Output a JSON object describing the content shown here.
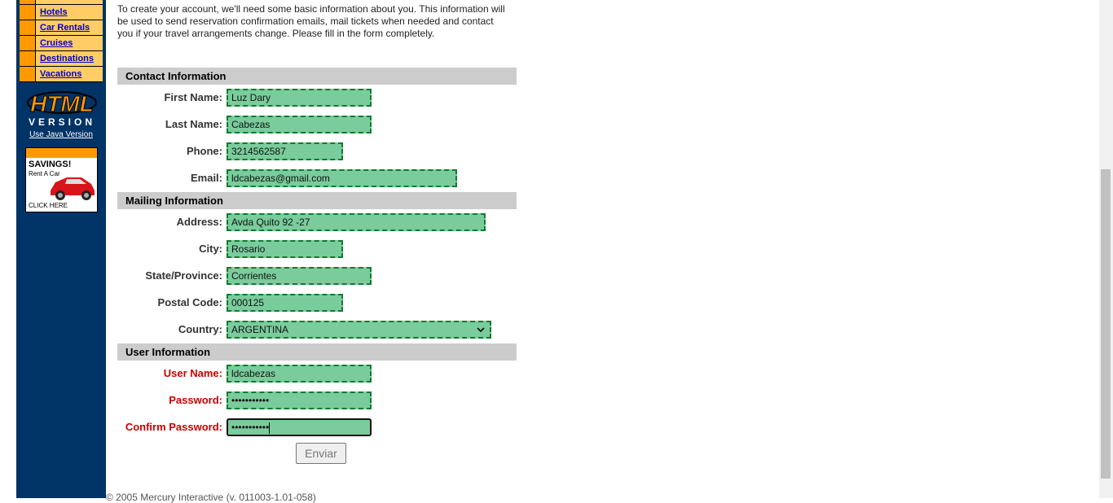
{
  "sidebar": {
    "nav_items": [
      "Hotels",
      "Car Rentals",
      "Cruises",
      "Destinations",
      "Vacations"
    ],
    "logo_line1": "HTML",
    "logo_line2": "VERSION",
    "java_link": "Use Java Version",
    "ad": {
      "title": "SAVINGS!",
      "subtitle": "Rent A Car",
      "cta": "CLICK HERE"
    }
  },
  "intro": "To create your account, we'll need some basic information about you. This information will be used to send reservation confirmation emails, mail tickets when needed and contact you if your travel arrangements change. Please fill in the form completely.",
  "sections": {
    "contact": "Contact Information",
    "mailing": "Mailing Information",
    "user": "User Information"
  },
  "fields": {
    "first_name": {
      "label": "First Name:",
      "value": "Luz Dary"
    },
    "last_name": {
      "label": "Last Name:",
      "value": "Cabezas"
    },
    "phone": {
      "label": "Phone:",
      "value": "3214562587"
    },
    "email": {
      "label": "Email:",
      "value": "ldcabezas@gmail.com"
    },
    "address": {
      "label": "Address:",
      "value": "Avda Quito 92 -27"
    },
    "city": {
      "label": "City:",
      "value": "Rosario"
    },
    "state": {
      "label": "State/Province:",
      "value": "Corrientes"
    },
    "postal": {
      "label": "Postal Code:",
      "value": "000125"
    },
    "country": {
      "label": "Country:",
      "value": "ARGENTINA"
    },
    "username": {
      "label": "User Name:",
      "value": "ldcabezas"
    },
    "password": {
      "label": "Password:",
      "value": "•••••••••••"
    },
    "confirm_password": {
      "label": "Confirm Password:",
      "value": "•••••••••••"
    }
  },
  "submit_label": "Enviar",
  "footer": "© 2005 Mercury Interactive (v. 011003-1.01-058)",
  "colors": {
    "sidebar": "#003366",
    "field_bg": "#7acc9c",
    "field_border": "#107a30",
    "required_label": "#cc0000"
  }
}
